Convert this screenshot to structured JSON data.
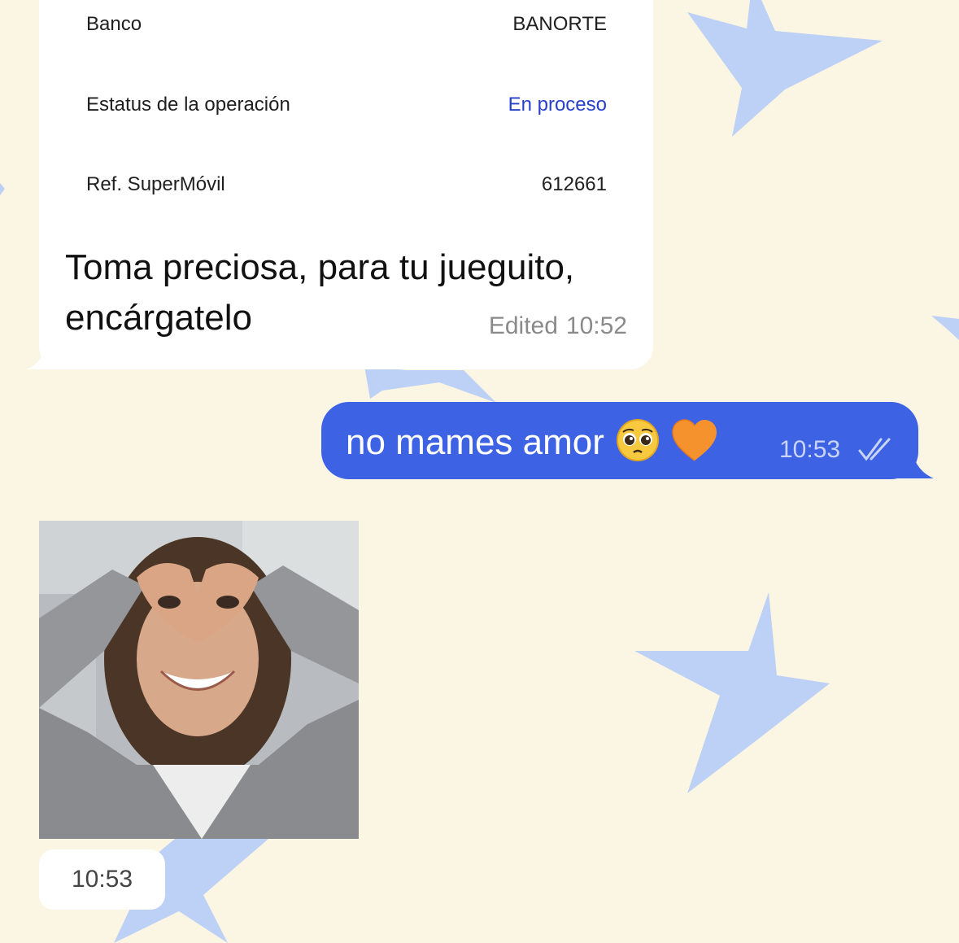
{
  "theme": {
    "background": "#fbf6e3",
    "star_color": "#bdd0f5",
    "outgoing_bubble": "#3d63e4",
    "incoming_bubble": "#ffffff",
    "status_blue": "#2741c8"
  },
  "incoming_message": {
    "receipt": [
      {
        "label": "Banco",
        "value": "BANORTE"
      },
      {
        "label": "Estatus de la operación",
        "value": "En proceso"
      },
      {
        "label": "Ref. SuperMóvil",
        "value": "612661"
      }
    ],
    "text": "Toma preciosa, para tu jueguito, encárgatelo",
    "edited_label": "Edited",
    "time": "10:52"
  },
  "outgoing_message": {
    "text": "no mames amor",
    "emojis": [
      "pleading-face",
      "orange-heart"
    ],
    "time": "10:53",
    "status": "read-double-check"
  },
  "photo_message": {
    "time": "10:53"
  }
}
